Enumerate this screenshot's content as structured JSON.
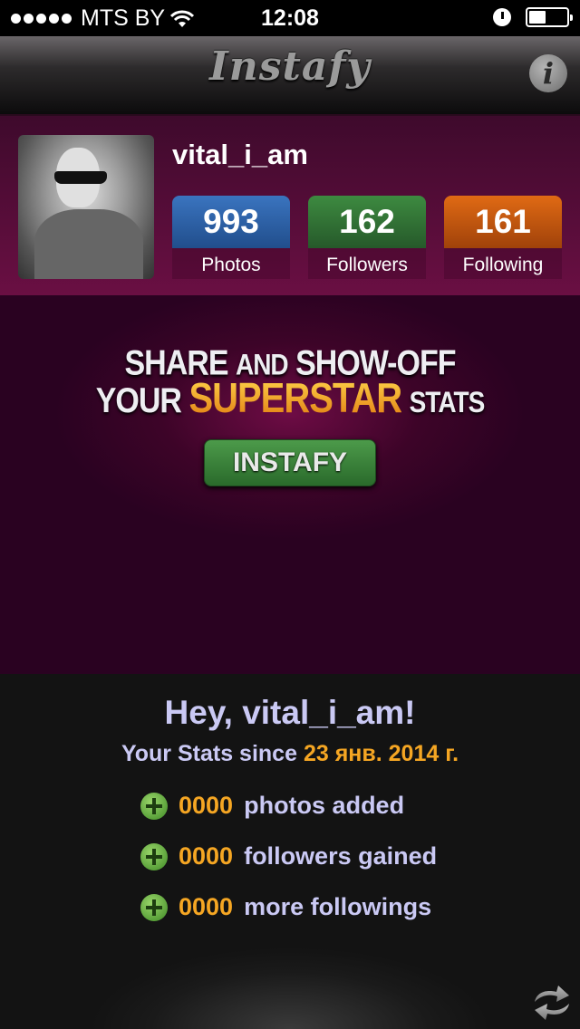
{
  "status_bar": {
    "carrier": "MTS BY",
    "time": "12:08",
    "battery_level": 0.4
  },
  "nav": {
    "title": "Instafy",
    "info_label": "i"
  },
  "profile": {
    "username": "vital_i_am",
    "stats": [
      {
        "value": "993",
        "label": "Photos",
        "color": "#2f64a8"
      },
      {
        "value": "162",
        "label": "Followers",
        "color": "#357a38"
      },
      {
        "value": "161",
        "label": "Following",
        "color": "#c9570f"
      }
    ]
  },
  "promo": {
    "line1_a": "SHARE",
    "line1_b": "AND",
    "line1_c": "SHOW-OFF",
    "line2_a": "YOUR",
    "line2_b": "SUPERSTAR",
    "line2_c": "STATS",
    "button_label": "INSTAFY"
  },
  "stats_summary": {
    "greeting": "Hey, vital_i_am!",
    "since_prefix": "Your Stats since",
    "since_date": "23 янв. 2014 г.",
    "rows": [
      {
        "count": "0000",
        "text": "photos added"
      },
      {
        "count": "0000",
        "text": "followers gained"
      },
      {
        "count": "0000",
        "text": "more followings"
      }
    ]
  },
  "colors": {
    "accent_orange": "#f5a623",
    "text_lavender": "#cac9f4",
    "profile_bg": "#6a0f43"
  }
}
